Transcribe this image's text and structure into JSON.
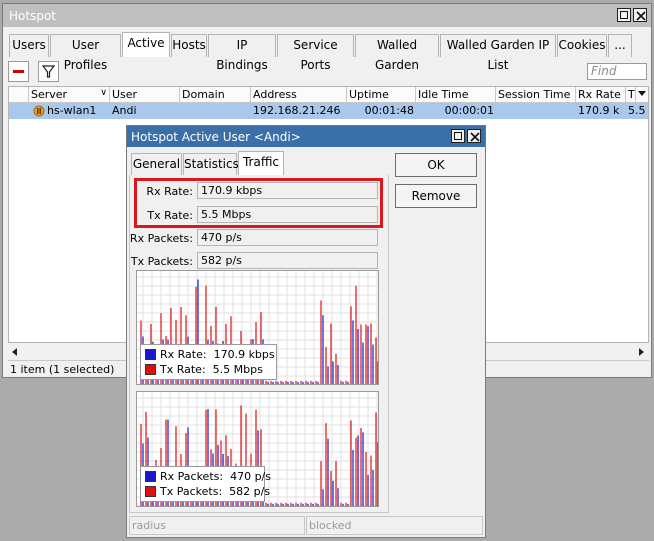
{
  "window": {
    "title": "Hotspot",
    "tabs": [
      "Users",
      "User Profiles",
      "Active",
      "Hosts",
      "IP Bindings",
      "Service Ports",
      "Walled Garden",
      "Walled Garden IP List",
      "Cookies",
      "..."
    ],
    "active_tab": "Active",
    "find_placeholder": "Find",
    "columns": [
      "Server",
      "User",
      "Domain",
      "Address",
      "Uptime",
      "Idle Time",
      "Session Time ...",
      "Rx Rate",
      "T"
    ],
    "rows": [
      {
        "server": "hs-wlan1",
        "user": "Andi",
        "domain": "",
        "address": "192.168.21.246",
        "uptime": "00:01:48",
        "idle_time": "00:00:01",
        "session_time": "",
        "rx_rate": "170.9 k",
        "tx_rate": "5.5 I"
      }
    ],
    "status": "1 item (1 selected)"
  },
  "dialog": {
    "title": "Hotspot Active User <Andi>",
    "tabs": [
      "General",
      "Statistics",
      "Traffic"
    ],
    "active_tab": "Traffic",
    "fields": {
      "rx_rate_label": "Rx Rate:",
      "rx_rate_value": "170.9 kbps",
      "tx_rate_label": "Tx Rate:",
      "tx_rate_value": "5.5 Mbps",
      "rx_packets_label": "Rx Packets:",
      "rx_packets_value": "470 p/s",
      "tx_packets_label": "Tx Packets:",
      "tx_packets_value": "582 p/s"
    },
    "buttons": {
      "ok": "OK",
      "remove": "Remove"
    },
    "rate_legend": [
      {
        "label": "Rx Rate:",
        "value": "170.9 kbps",
        "color": "#1818cc"
      },
      {
        "label": "Tx Rate:",
        "value": "5.5 Mbps",
        "color": "#e01010"
      }
    ],
    "packets_legend": [
      {
        "label": "Rx Packets:",
        "value": "470 p/s",
        "color": "#1818cc"
      },
      {
        "label": "Tx Packets:",
        "value": "582 p/s",
        "color": "#e01010"
      }
    ],
    "status": [
      "radius",
      "blocked"
    ]
  },
  "colors": {
    "accent_title": "#3a6fa8",
    "selection": "#a9c8ec",
    "rx": "#1818cc",
    "tx": "#e01010",
    "highlight": "#d9181f"
  }
}
